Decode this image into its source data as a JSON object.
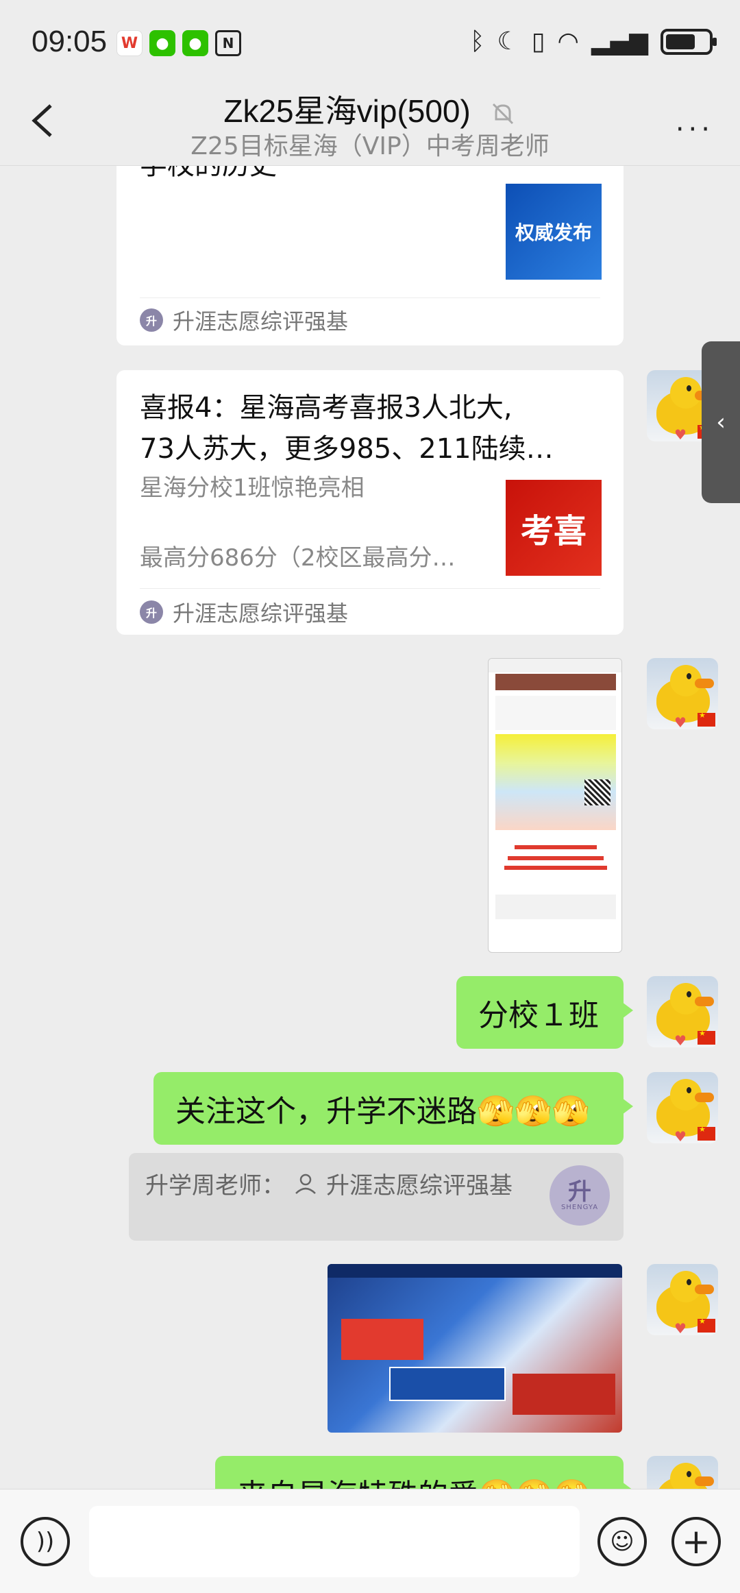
{
  "status_bar": {
    "time": "09:05",
    "battery_level": 0.7
  },
  "header": {
    "title": "Zk25星海vip(500)",
    "subtitle": "Z25目标星海（VIP）中考周老师",
    "more": "···"
  },
  "messages": {
    "card1": {
      "partial_title": "学校的历史",
      "thumb_text": "权威发布",
      "source": "升涯志愿综评强基"
    },
    "card2": {
      "title_line1": "喜报4：星海高考喜报3人北大,",
      "title_line2": "73人苏大，更多985、211陆续…",
      "desc_line1": "星海分校1班惊艳亮相",
      "desc_line2": "最高分686分（2校区最高分…",
      "thumb_text": "考喜",
      "source": "升涯志愿综评强基"
    },
    "text1": "分校１班",
    "text2": "关注这个，升学不迷路🫣🫣🫣",
    "quote": {
      "label": "升学周老师：",
      "name": "升涯志愿综评强基",
      "logo_big": "升",
      "logo_small": "SHENGYA"
    },
    "text3": "来自星海特殊的爱🫣🫣🫣"
  },
  "bottom": {
    "emoji": "☺",
    "plus": "+"
  },
  "colors": {
    "bubble_green": "#95ec69",
    "background": "#ededed"
  }
}
